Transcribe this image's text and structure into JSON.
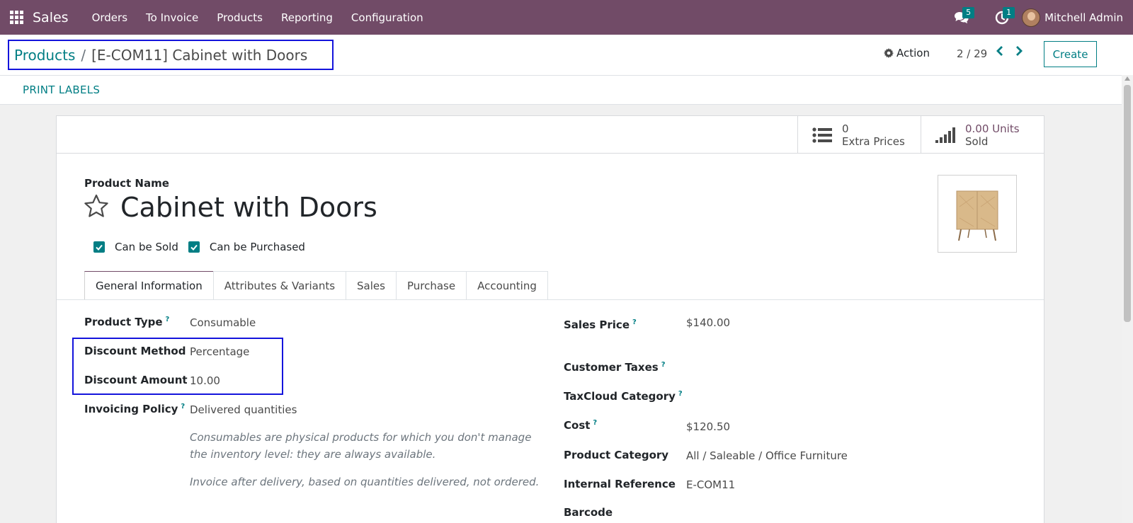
{
  "navbar": {
    "app_name": "Sales",
    "menu": [
      "Orders",
      "To Invoice",
      "Products",
      "Reporting",
      "Configuration"
    ],
    "messages_count": "5",
    "activities_count": "1",
    "user_name": "Mitchell Admin"
  },
  "control_panel": {
    "breadcrumb_parent": "Products",
    "breadcrumb_separator": "/",
    "breadcrumb_current": "[E-COM11] Cabinet with Doors",
    "action_label": "Action",
    "pager": "2 / 29",
    "create_label": "Create",
    "print_labels": "PRINT LABELS"
  },
  "stat_buttons": {
    "extra_prices_value": "0",
    "extra_prices_label": "Extra Prices",
    "sold_value": "0.00 Units",
    "sold_label": "Sold"
  },
  "product": {
    "name_label": "Product Name",
    "name": "Cabinet with Doors",
    "can_be_sold_label": "Can be Sold",
    "can_be_sold": true,
    "can_be_purchased_label": "Can be Purchased",
    "can_be_purchased": true
  },
  "tabs": [
    "General Information",
    "Attributes & Variants",
    "Sales",
    "Purchase",
    "Accounting"
  ],
  "active_tab": "General Information",
  "general_info": {
    "left": {
      "product_type_label": "Product Type",
      "product_type": "Consumable",
      "discount_method_label": "Discount Method",
      "discount_method": "Percentage",
      "discount_amount_label": "Discount Amount",
      "discount_amount": "10.00",
      "invoicing_policy_label": "Invoicing Policy",
      "invoicing_policy": "Delivered quantities",
      "note_consumable": "Consumables are physical products for which you don't manage the inventory level: they are always available.",
      "note_invoice": "Invoice after delivery, based on quantities delivered, not ordered."
    },
    "right": {
      "sales_price_label": "Sales Price",
      "sales_price": "$140.00",
      "customer_taxes_label": "Customer Taxes",
      "taxcloud_label": "TaxCloud Category",
      "cost_label": "Cost",
      "cost": "$120.50",
      "product_category_label": "Product Category",
      "product_category": "All / Saleable / Office Furniture",
      "internal_ref_label": "Internal Reference",
      "internal_ref": "E-COM11",
      "barcode_label": "Barcode"
    },
    "help_mark": "?"
  },
  "colors": {
    "navbar": "#714b67",
    "accent": "#017e84",
    "highlight": "#1414dc"
  }
}
